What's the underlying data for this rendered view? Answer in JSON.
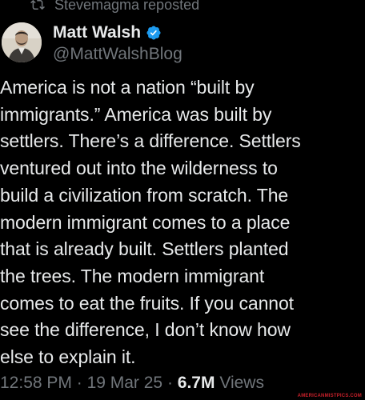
{
  "repost": {
    "icon": "repost-icon",
    "label": "Stevemagma reposted"
  },
  "author": {
    "display_name": "Matt Walsh",
    "handle": "@MattWalshBlog",
    "verified": true,
    "verified_color": "#1d9bf0"
  },
  "tweet": {
    "lines": [
      "America is not a nation “built by",
      "immigrants.” America was built by",
      "settlers. There’s a difference. Settlers",
      "ventured out into the wilderness to",
      "build a civilization from scratch. The",
      "modern immigrant comes to a place",
      "that is already built. Settlers planted",
      "the trees. The modern immigrant",
      "comes to eat the fruits. If you cannot",
      "see the difference, I don’t know how",
      "else to explain it."
    ]
  },
  "meta": {
    "time": "12:58 PM",
    "sep1": " · ",
    "date": "19 Mar 25",
    "sep2": " · ",
    "views_count": "6.7M",
    "views_label": " Views"
  },
  "watermark": "AMERICANMISTPICS.COM",
  "colors": {
    "background": "#000000",
    "text": "#e7e9ea",
    "secondary": "#71767b"
  }
}
